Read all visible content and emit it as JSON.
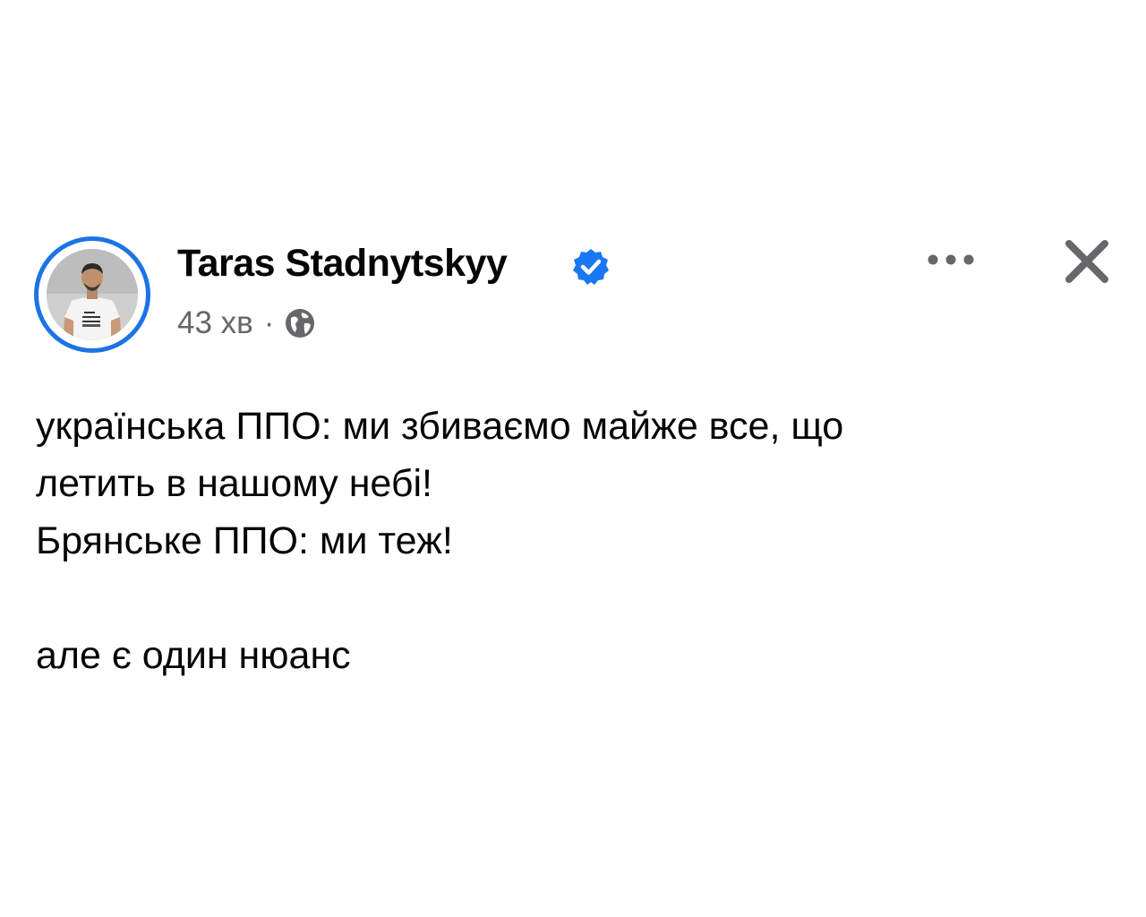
{
  "post": {
    "author": {
      "name": "Taras Stadnytskyy",
      "verified": true,
      "avatar_shirt_text": [
        "TARAS",
        "STADNYTSKYY",
        "BREAK EVERY"
      ]
    },
    "meta": {
      "time": "43 хв",
      "separator": "·",
      "audience_icon": "globe-icon"
    },
    "actions": {
      "more_icon": "more-options-icon",
      "close_icon": "close-icon"
    },
    "text_lines": [
      "українська ППО: ми збиваємо майже все, що",
      "летить в нашому небі!",
      "Брянське ППО: ми теж!",
      "але є один нюанс"
    ]
  },
  "colors": {
    "accent_blue": "#1b74e4",
    "verified_blue": "#1877f2",
    "text_primary": "#050505",
    "text_secondary": "#65676b"
  }
}
